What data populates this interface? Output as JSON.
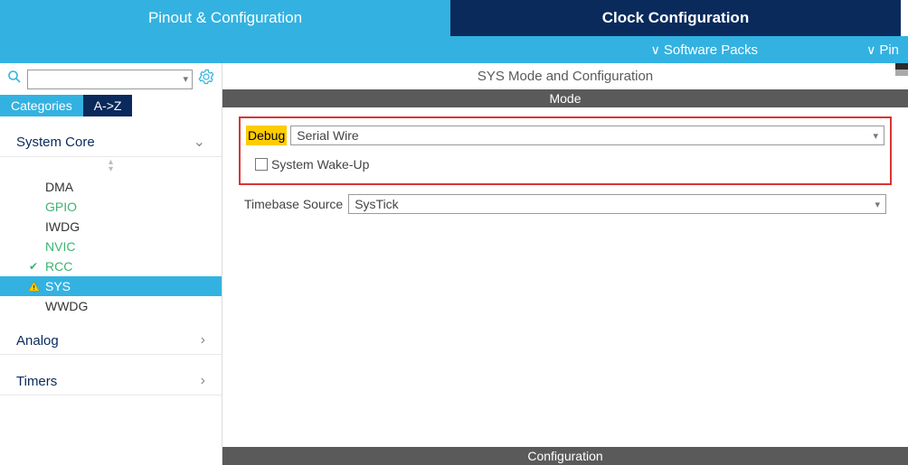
{
  "tabs": {
    "pinout": "Pinout & Configuration",
    "clock": "Clock Configuration"
  },
  "subbar": {
    "software_packs": "Software Packs",
    "pin": "Pin"
  },
  "sidebar": {
    "tabs": {
      "categories": "Categories",
      "az": "A->Z"
    },
    "groups": {
      "system_core": {
        "label": "System Core"
      },
      "analog": {
        "label": "Analog"
      },
      "timers": {
        "label": "Timers"
      }
    },
    "items": {
      "dma": "DMA",
      "gpio": "GPIO",
      "iwdg": "IWDG",
      "nvic": "NVIC",
      "rcc": "RCC",
      "sys": "SYS",
      "wwdg": "WWDG"
    }
  },
  "panel": {
    "title": "SYS Mode and Configuration",
    "mode_header": "Mode",
    "config_header": "Configuration",
    "debug_label": "Debug",
    "debug_value": "Serial Wire",
    "wakeup_label": "System Wake-Up",
    "timebase_label": "Timebase Source",
    "timebase_value": "SysTick"
  }
}
